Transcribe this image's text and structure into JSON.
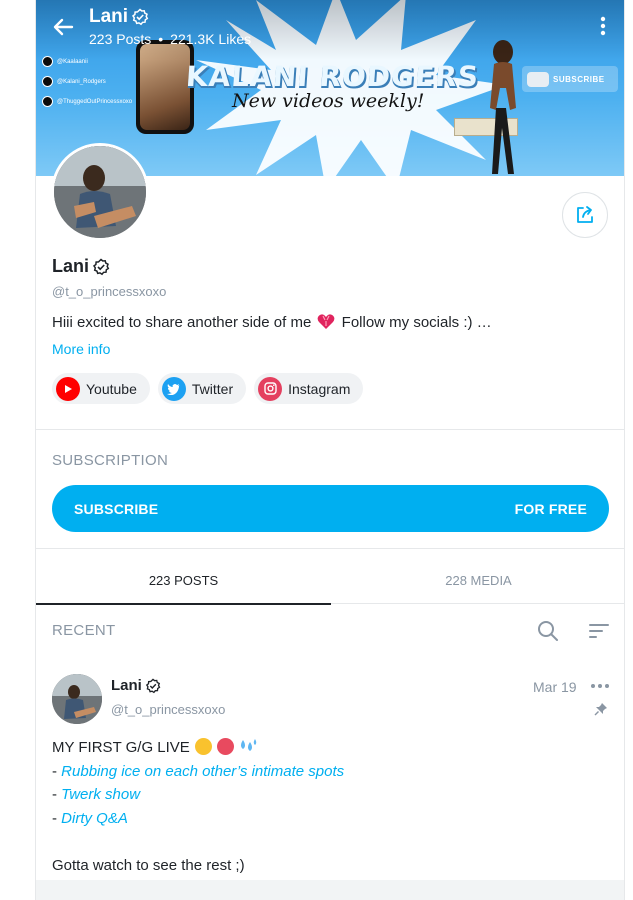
{
  "header": {
    "name": "Lani",
    "posts_count": "223 Posts",
    "likes_count": "221.3K Likes"
  },
  "banner": {
    "brand_text": "KALANI RODGERS",
    "tagline": "New videos weekly!",
    "subscribe_graphic": "SUBSCRIBE",
    "socials": [
      "@Kaalaanii",
      "@Kalani_Rodgers",
      "@ThuggedOutPrincessxoxo"
    ]
  },
  "profile": {
    "name": "Lani",
    "handle": "@t_o_princessxoxo",
    "bio": "Hiii excited to share another side of me",
    "bio_suffix": "Follow my socials :) …",
    "more_info": "More info",
    "links": [
      {
        "label": "Youtube",
        "color": "#ff0000",
        "icon": "youtube-icon"
      },
      {
        "label": "Twitter",
        "color": "#1da1f2",
        "icon": "twitter-icon"
      },
      {
        "label": "Instagram",
        "color": "#e4405f",
        "icon": "instagram-icon"
      }
    ]
  },
  "subscription": {
    "title": "SUBSCRIPTION",
    "button_label": "SUBSCRIBE",
    "button_price": "FOR FREE"
  },
  "tabs": [
    {
      "label": "223 POSTS",
      "active": true
    },
    {
      "label": "228 MEDIA",
      "active": false
    }
  ],
  "recent": {
    "title": "RECENT"
  },
  "post": {
    "author": "Lani",
    "handle": "@t_o_princessxoxo",
    "date": "Mar 19",
    "line1": "MY FIRST G/G LIVE",
    "items": [
      "Rubbing ice on each other’s intimate spots",
      "Twerk show",
      "Dirty Q&A"
    ],
    "bullet": "- ",
    "footer": "Gotta watch to see the rest ;)"
  },
  "colors": {
    "accent": "#00aff0",
    "muted": "#8a96a3",
    "text": "#1f2328"
  }
}
